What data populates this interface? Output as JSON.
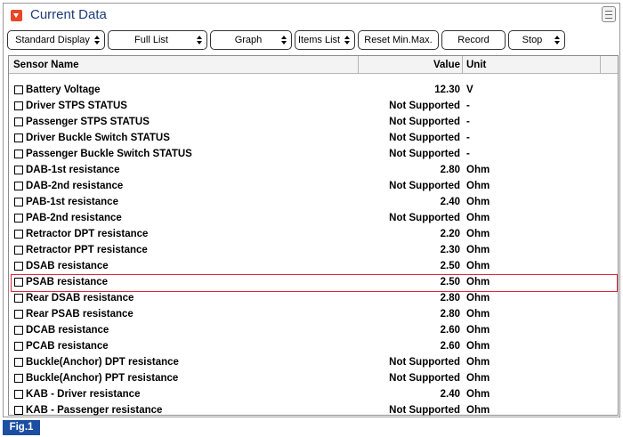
{
  "window": {
    "title": "Current Data"
  },
  "toolbar": {
    "standard_display": "Standard Display",
    "full_list": "Full List",
    "graph": "Graph",
    "items_list": "Items List",
    "reset_minmax": "Reset Min.Max.",
    "record": "Record",
    "stop": "Stop"
  },
  "table": {
    "headers": {
      "name": "Sensor Name",
      "value": "Value",
      "unit": "Unit"
    },
    "rows": [
      {
        "name": "Battery Voltage",
        "value": "12.30",
        "unit": "V"
      },
      {
        "name": "Driver STPS STATUS",
        "value": "Not Supported",
        "unit": "-"
      },
      {
        "name": "Passenger STPS STATUS",
        "value": "Not Supported",
        "unit": "-"
      },
      {
        "name": "Driver Buckle Switch STATUS",
        "value": "Not Supported",
        "unit": "-"
      },
      {
        "name": "Passenger Buckle Switch STATUS",
        "value": "Not Supported",
        "unit": "-"
      },
      {
        "name": "DAB-1st resistance",
        "value": "2.80",
        "unit": "Ohm"
      },
      {
        "name": "DAB-2nd resistance",
        "value": "Not Supported",
        "unit": "Ohm"
      },
      {
        "name": "PAB-1st resistance",
        "value": "2.40",
        "unit": "Ohm"
      },
      {
        "name": "PAB-2nd resistance",
        "value": "Not Supported",
        "unit": "Ohm"
      },
      {
        "name": "Retractor DPT resistance",
        "value": "2.20",
        "unit": "Ohm"
      },
      {
        "name": "Retractor PPT resistance",
        "value": "2.30",
        "unit": "Ohm"
      },
      {
        "name": "DSAB resistance",
        "value": "2.50",
        "unit": "Ohm"
      },
      {
        "name": "PSAB resistance",
        "value": "2.50",
        "unit": "Ohm"
      },
      {
        "name": "Rear DSAB resistance",
        "value": "2.80",
        "unit": "Ohm"
      },
      {
        "name": "Rear PSAB resistance",
        "value": "2.80",
        "unit": "Ohm"
      },
      {
        "name": "DCAB resistance",
        "value": "2.60",
        "unit": "Ohm"
      },
      {
        "name": "PCAB resistance",
        "value": "2.60",
        "unit": "Ohm"
      },
      {
        "name": "Buckle(Anchor) DPT resistance",
        "value": "Not Supported",
        "unit": "Ohm"
      },
      {
        "name": "Buckle(Anchor) PPT resistance",
        "value": "Not Supported",
        "unit": "Ohm"
      },
      {
        "name": "KAB - Driver resistance",
        "value": "2.40",
        "unit": "Ohm"
      },
      {
        "name": "KAB - Passenger resistance",
        "value": "Not Supported",
        "unit": "Ohm"
      }
    ],
    "selected_row": 12
  },
  "figure_label": "Fig.1",
  "colors": {
    "title": "#1f3b77",
    "collapse_icon": "#e8462a",
    "selection_border": "#e0283a",
    "figure_label_bg": "#1c4fa3"
  }
}
